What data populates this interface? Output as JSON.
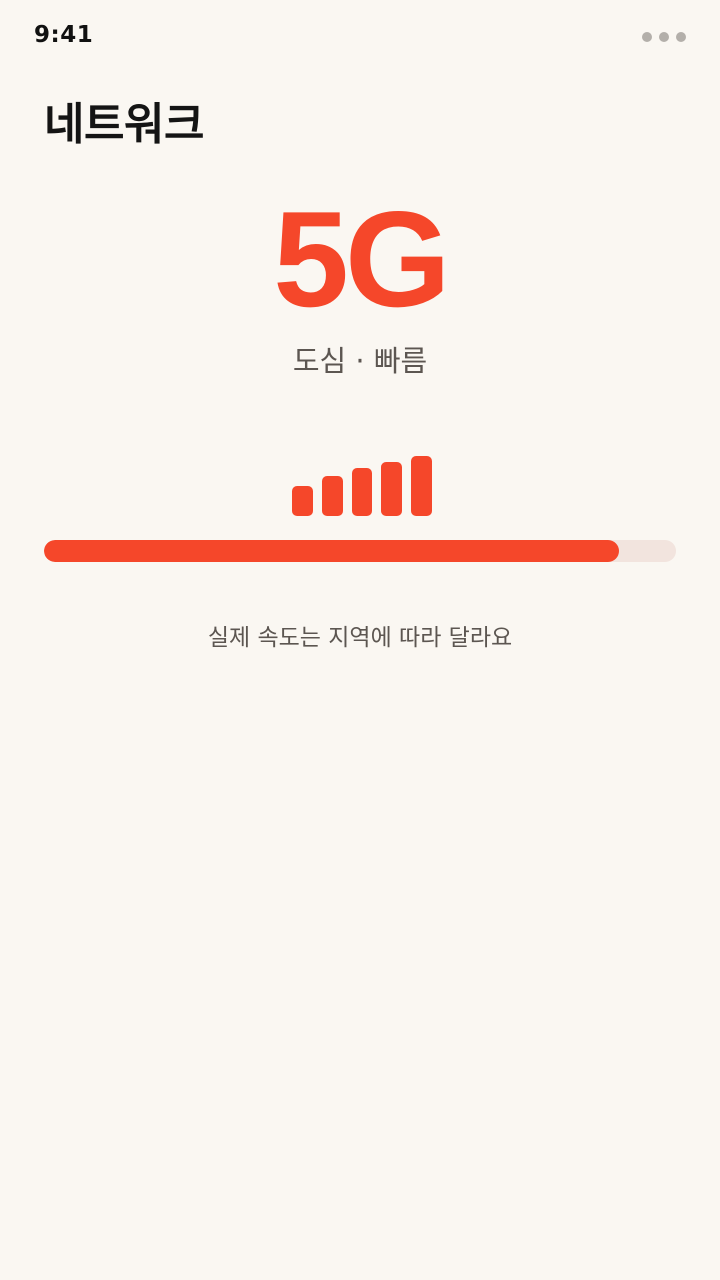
{
  "status_bar": {
    "time": "9:41",
    "more_icon": "more-horizontal-icon"
  },
  "header": {
    "title": "네트워크"
  },
  "network": {
    "type": "5G",
    "subtitle": "도심 · 빠름",
    "signal_icon": "signal-bars-icon",
    "signal_levels": [
      0.5,
      0.66,
      0.8,
      0.9,
      1.0
    ],
    "progress_fraction": 0.91
  },
  "footnote": "실제 속도는 지역에 따라 달라요",
  "colors": {
    "accent": "#F5472A",
    "track": "#F2E4DE",
    "background": "#FAF7F2"
  }
}
